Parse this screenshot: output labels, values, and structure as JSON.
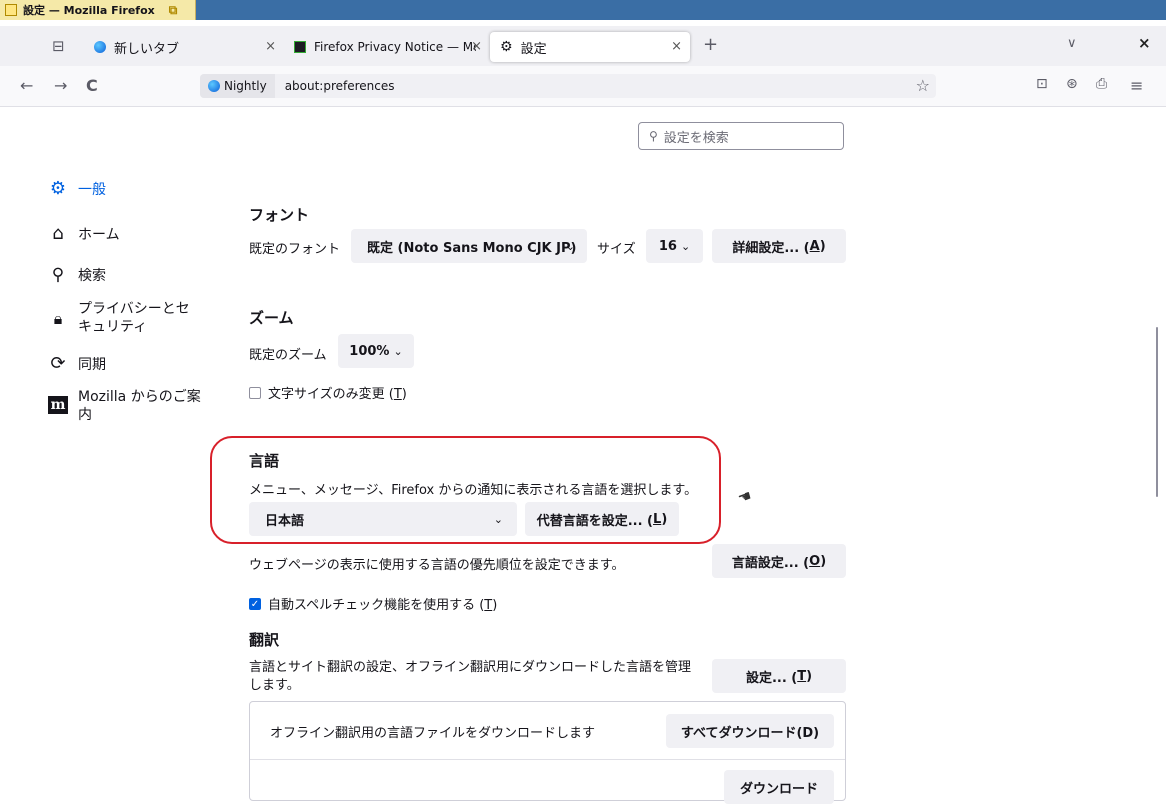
{
  "window": {
    "title": "設定 — Mozilla Firefox"
  },
  "tabs": [
    {
      "label": "新しいタブ",
      "close": "×"
    },
    {
      "label": "Firefox Privacy Notice — Mo",
      "close": "×"
    },
    {
      "label": "設定",
      "close": "×"
    }
  ],
  "tabstrip": {
    "new_tab": "+",
    "list_all": "∨",
    "window_close": "×"
  },
  "navbar": {
    "back": "←",
    "forward": "→",
    "reload": "C",
    "identity": "Nightly",
    "url": "about:preferences",
    "bookmark": "☆",
    "pocket": "⊡",
    "account": "⊛",
    "extensions": "⎙",
    "menu": "≡"
  },
  "search": {
    "placeholder": "設定を検索"
  },
  "sidebar": {
    "items": [
      {
        "label": "一般"
      },
      {
        "label": "ホーム"
      },
      {
        "label": "検索"
      },
      {
        "label": "プライバシーとセキュリティ",
        "line1": "プライバシーとセ",
        "line2": "キュリティ"
      },
      {
        "label": "同期"
      },
      {
        "label": "Mozilla からのご案内",
        "line1": "Mozilla からのご案",
        "line2": "内",
        "icon_text": "m"
      }
    ]
  },
  "fonts": {
    "heading": "フォント",
    "default_font_label": "既定のフォント",
    "default_font_value": "既定 (Noto Sans Mono CJK JP)",
    "size_label": "サイズ",
    "size_value": "16",
    "advanced_label": "詳細設定... (",
    "advanced_key": "A",
    "advanced_end": ")"
  },
  "zoom": {
    "heading": "ズーム",
    "default_zoom_label": "既定のズーム",
    "default_zoom_value": "100%",
    "text_only_label": "文字サイズのみ変更 (",
    "text_only_key": "T",
    "text_only_end": ")",
    "text_only_checked": false
  },
  "language": {
    "heading": "言語",
    "description": "メニュー、メッセージ、Firefox からの通知に表示される言語を選択します。",
    "selected": "日本語",
    "alternatives_label": "代替言語を設定... (",
    "alternatives_key": "L",
    "alternatives_end": ")",
    "webpage_desc": "ウェブページの表示に使用する言語の優先順位を設定できます。",
    "choose_label": "言語設定... (",
    "choose_key": "O",
    "choose_end": ")",
    "spellcheck_label": "自動スペルチェック機能を使用する (",
    "spellcheck_key": "T",
    "spellcheck_end": ")",
    "spellcheck_checked": true
  },
  "translation": {
    "heading": "翻訳",
    "description": "言語とサイト翻訳の設定、オフライン翻訳用にダウンロードした言語を管理します。",
    "desc_line1": "言語とサイト翻訳の設定、オフライン翻訳用にダウンロードした言語を管理",
    "desc_line2": "します。",
    "settings_label": "設定... (",
    "settings_key": "T",
    "settings_end": ")",
    "download_desc": "オフライン翻訳用の言語ファイルをダウンロードします",
    "download_all": "すべてダウンロード(D)",
    "download_one": "ダウンロード"
  },
  "colors": {
    "accent": "#0061e0",
    "highlight": "#d8202a",
    "titlebar": "#3a6ea5"
  }
}
